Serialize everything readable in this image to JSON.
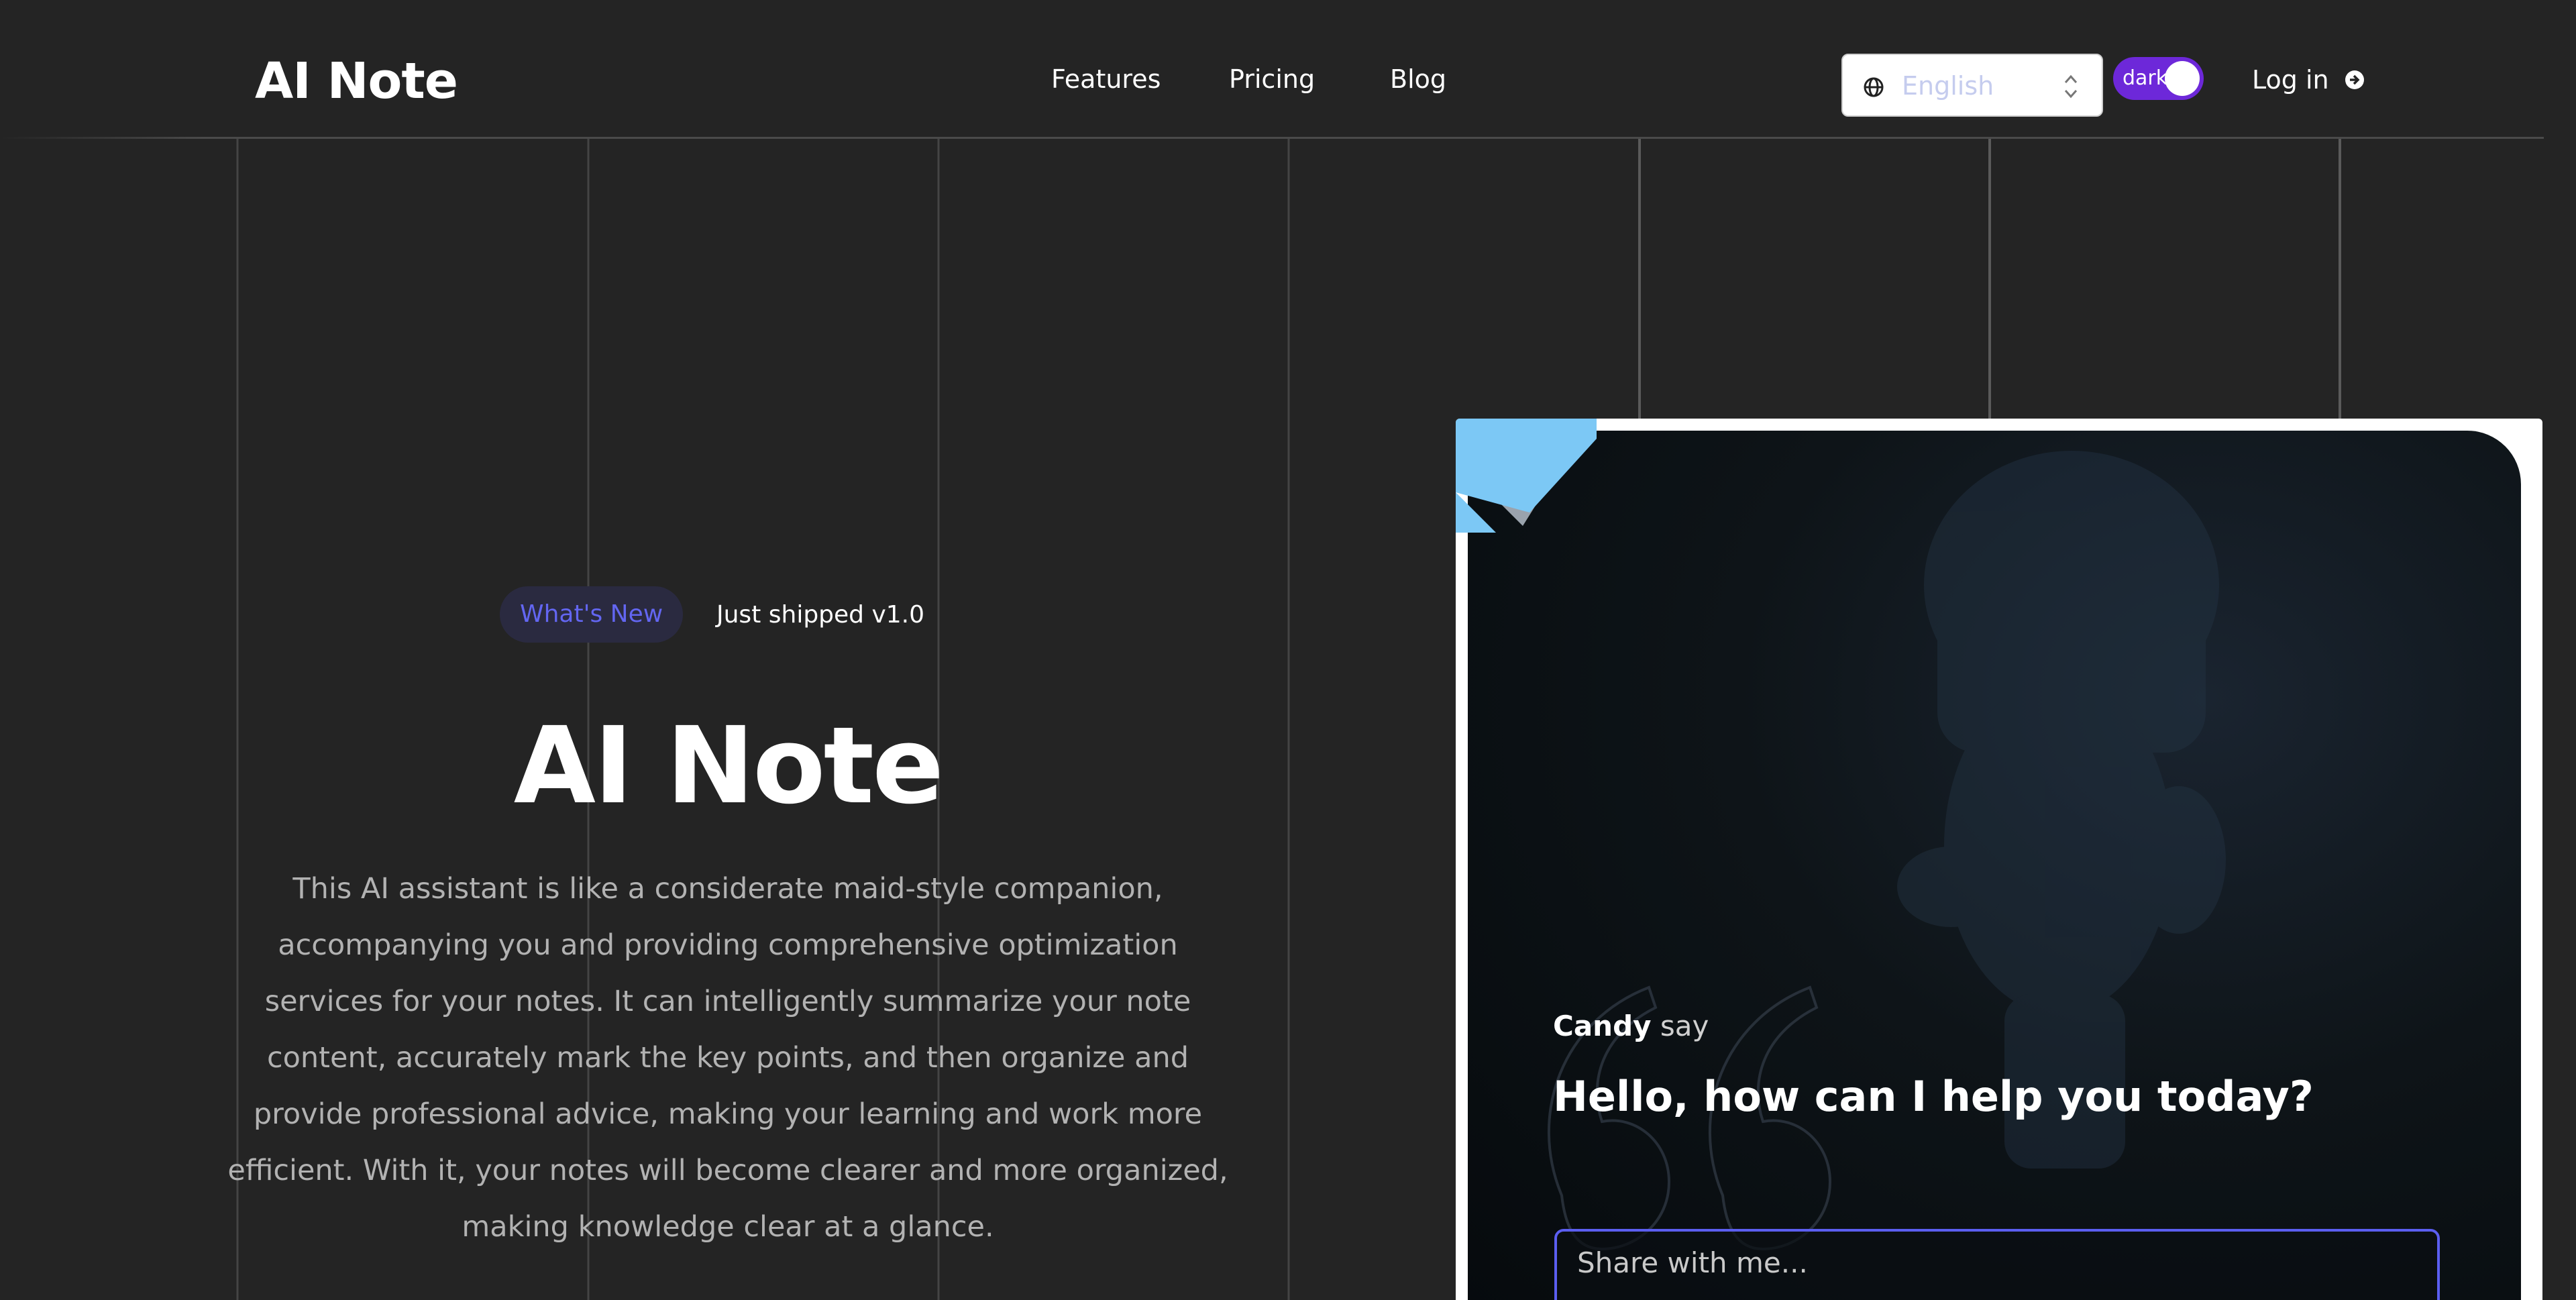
{
  "header": {
    "logo": "AI Note",
    "nav": {
      "features": "Features",
      "pricing": "Pricing",
      "blog": "Blog"
    },
    "language": {
      "selected": "English",
      "icon": "globe-icon"
    },
    "theme_toggle": {
      "label": "dark",
      "state": "on"
    },
    "login": {
      "label": "Log in",
      "icon": "arrow-right-circle-icon"
    }
  },
  "hero": {
    "badge": "What's New",
    "badge_text": "Just shipped v1.0",
    "title": "AI Note",
    "description": "This AI assistant is like a considerate maid-style companion, accompanying you and providing comprehensive optimization services for your notes. It can intelligently summarize your note content, accurately mark the key points, and then organize and provide professional advice, making your learning and work more efficient. With it, your notes will become clearer and more organized, making knowledge clear at a glance."
  },
  "chat": {
    "speaker_name": "Candy",
    "speaker_verb": "say",
    "greeting": "Hello, how can I help you today?",
    "input_placeholder": "Share with me..."
  },
  "colors": {
    "background": "#242424",
    "accent_purple": "#6d28d9",
    "badge_text": "#6366f1",
    "input_border": "#5b5ef0",
    "corner_blue": "#7cc8f5"
  }
}
